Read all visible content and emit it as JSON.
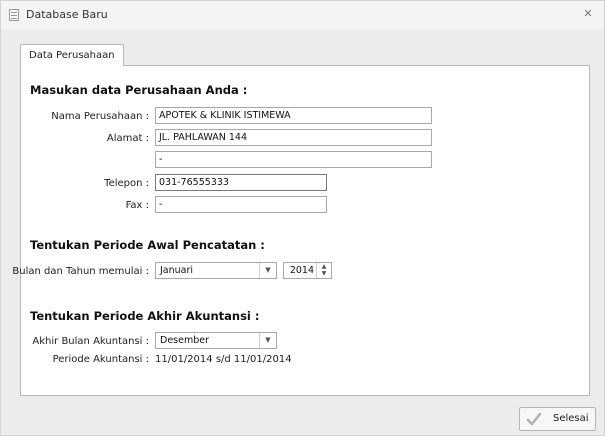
{
  "window": {
    "title": "Database Baru",
    "close_icon": "close-icon"
  },
  "tab": {
    "label": "Data Perusahaan"
  },
  "company": {
    "heading": "Masukan data Perusahaan Anda :",
    "name_label": "Nama Perusahaan :",
    "name_value": "APOTEK & KLINIK ISTIMEWA",
    "address_label": "Alamat :",
    "address1_value": "JL. PAHLAWAN 144",
    "address2_value": "-",
    "phone_label": "Telepon :",
    "phone_value": "031-76555333",
    "fax_label": "Fax :",
    "fax_value": "-"
  },
  "start_period": {
    "heading": "Tentukan Periode Awal Pencatatan :",
    "label": "Bulan dan Tahun memulai :",
    "month_value": "Januari",
    "year_value": "2014"
  },
  "end_period": {
    "heading": "Tentukan Periode Akhir Akuntansi :",
    "month_label": "Akhir Bulan Akuntansi :",
    "month_value": "Desember",
    "period_label": "Periode Akuntansi :",
    "period_value": "11/01/2014 s/d 11/01/2014"
  },
  "footer": {
    "finish_label": "Selesai",
    "finish_icon": "checkmark-icon"
  }
}
